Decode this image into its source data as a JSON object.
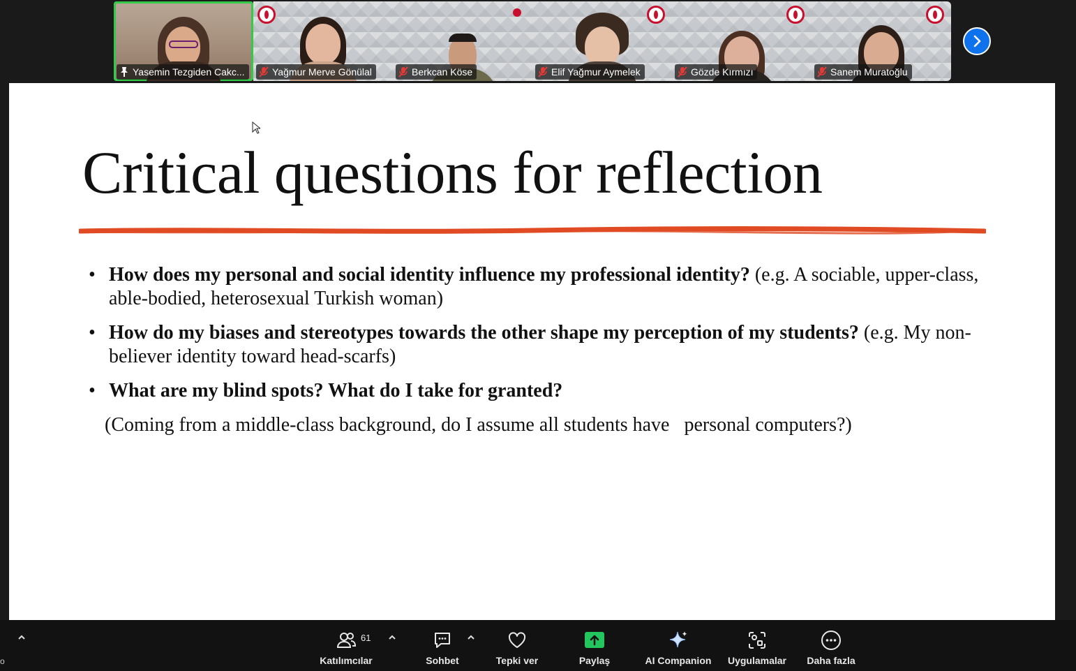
{
  "participants": [
    {
      "name": "Yasemin Tezgiden Cakc...",
      "muted": false,
      "pinned": true
    },
    {
      "name": "Yağmur Merve Gönülal",
      "muted": true
    },
    {
      "name": "Berkcan Köse",
      "muted": true
    },
    {
      "name": "Elif Yağmur Aymelek",
      "muted": true
    },
    {
      "name": "Gözde Kırmızı",
      "muted": true
    },
    {
      "name": "Sanem Muratoğlu",
      "muted": true
    }
  ],
  "slide": {
    "title": "Critical questions for reflection",
    "accent_color": "#e04b24",
    "bullets": [
      {
        "bold": "How does my personal and social identity influence my professional identity?",
        "normal": " (e.g. A sociable, upper-class, able-bodied, heterosexual Turkish woman)"
      },
      {
        "bold": "How do my biases and stereotypes towards the other shape my perception of my students?",
        "normal": " (e.g. My non-believer identity toward head-scarfs)"
      },
      {
        "bold": "What are my blind spots? What do I take for granted?",
        "normal": ""
      }
    ],
    "note": "(Coming from a middle-class background, do I assume all students have   personal computers?)"
  },
  "toolbar": {
    "participants_label": "Katılımcılar",
    "participants_count": "61",
    "chat_label": "Sohbet",
    "reactions_label": "Tepki ver",
    "share_label": "Paylaş",
    "share_color": "#22c55e",
    "ai_label": "AI Companion",
    "apps_label": "Uygulamalar",
    "more_label": "Daha fazla"
  },
  "edge_text": "o"
}
